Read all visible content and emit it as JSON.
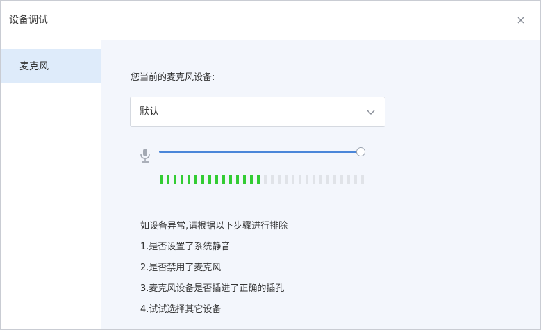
{
  "dialog": {
    "title": "设备调试",
    "close_icon": "close-icon"
  },
  "sidebar": {
    "items": [
      {
        "label": "麦克风",
        "selected": true
      }
    ]
  },
  "main": {
    "section_label": "您当前的麦克风设备:",
    "device_select": {
      "value": "默认",
      "icon": "chevron-down-icon"
    },
    "mic_icon": "microphone-icon",
    "volume_level_fraction": 1.0,
    "input_level": {
      "total_segments": 30,
      "active_segments": 15,
      "active_color": "#33cc33",
      "inactive_color": "#e0e3e8"
    },
    "instructions": [
      "如设备异常,请根据以下步骤进行排除",
      "1.是否设置了系统静音",
      "2.是否禁用了麦克风",
      "3.麦克风设备是否插进了正确的插孔",
      "4.试试选择其它设备"
    ]
  },
  "colors": {
    "accent": "#4a86d9",
    "sidebar_selected_bg": "#deebfa",
    "main_bg": "#f3f6fc"
  }
}
